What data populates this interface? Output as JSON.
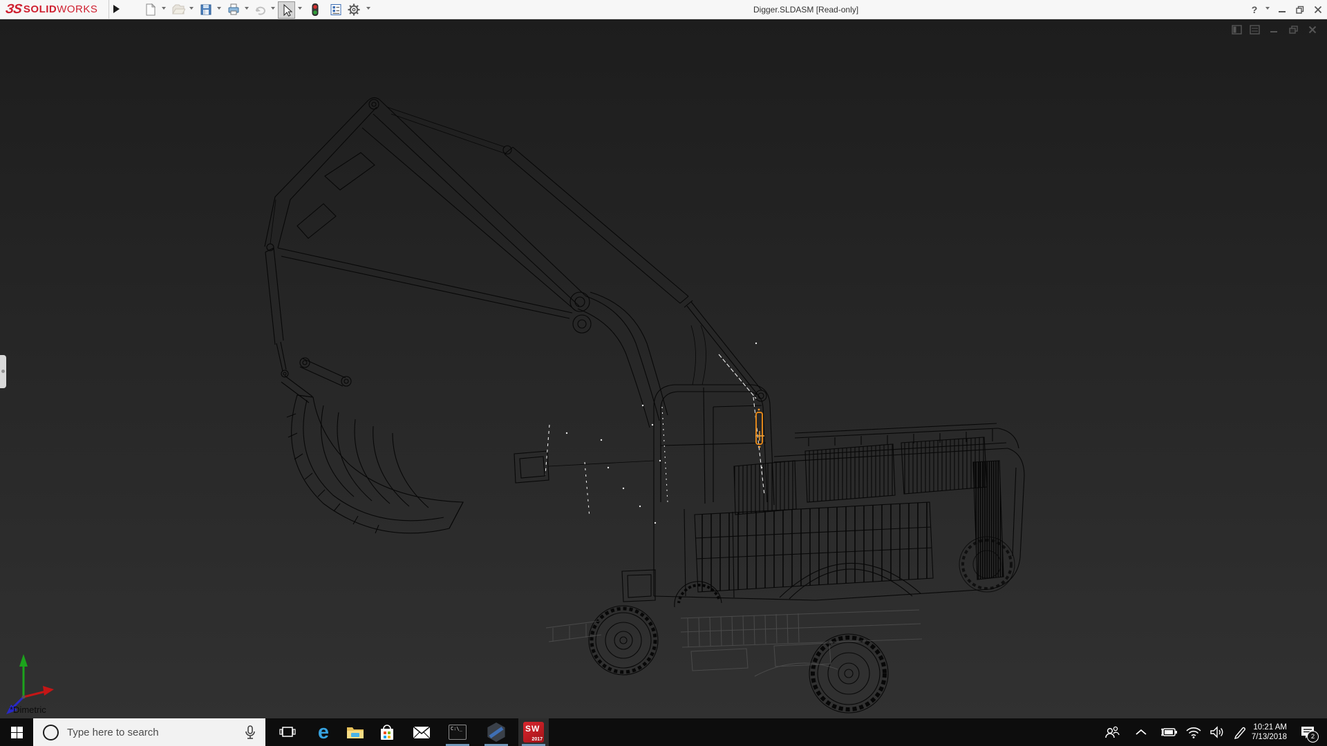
{
  "title_bar": {
    "logo": {
      "glyph": "ЗS",
      "brand_bold": "SOLID",
      "brand_light": "WORKS",
      "color": "#cf2030"
    },
    "document_title": "Digger.SLDASM [Read-only]",
    "controls": {
      "help": "?"
    },
    "toolbar_icons": [
      "new-document",
      "open-document",
      "save",
      "print",
      "undo",
      "select-cursor",
      "rebuild-traffic-light",
      "file-properties",
      "options-gear"
    ],
    "toolbar_state": {
      "open_disabled": true,
      "undo_disabled": true,
      "select_active": true
    }
  },
  "viewport": {
    "view_orientation_label": "*Dimetric",
    "selection_color": "#e0871c",
    "highlight_color": "#ededed",
    "background_top": "#1d1d1d",
    "background_bottom": "#313131",
    "child_window_icons": [
      "pane-toggle",
      "pane-list",
      "minimize",
      "restore",
      "close"
    ],
    "triad_axis_colors": {
      "x": "#c41616",
      "y": "#1ca31c",
      "z": "#2828c8"
    }
  },
  "taskbar": {
    "background": "#0d0d0d",
    "running_indicator_color": "#7097b8",
    "search": {
      "placeholder": "Type here to search"
    },
    "apps": [
      {
        "name": "task-view"
      },
      {
        "name": "edge",
        "letter": "e"
      },
      {
        "name": "file-explorer"
      },
      {
        "name": "store"
      },
      {
        "name": "mail"
      },
      {
        "name": "command-prompt",
        "label": "C:\\_",
        "running": true
      },
      {
        "name": "hexagon-3d-app",
        "running": true
      },
      {
        "name": "solidworks-2017",
        "label_top": "SW",
        "label_bottom": "2017",
        "running": true,
        "active": true
      }
    ],
    "tray": {
      "icons": [
        "people",
        "hidden-icons-chevron",
        "battery",
        "wifi",
        "volume",
        "pen"
      ],
      "time": "10:21 AM",
      "date": "7/13/2018",
      "action_center_badge": "2"
    }
  }
}
